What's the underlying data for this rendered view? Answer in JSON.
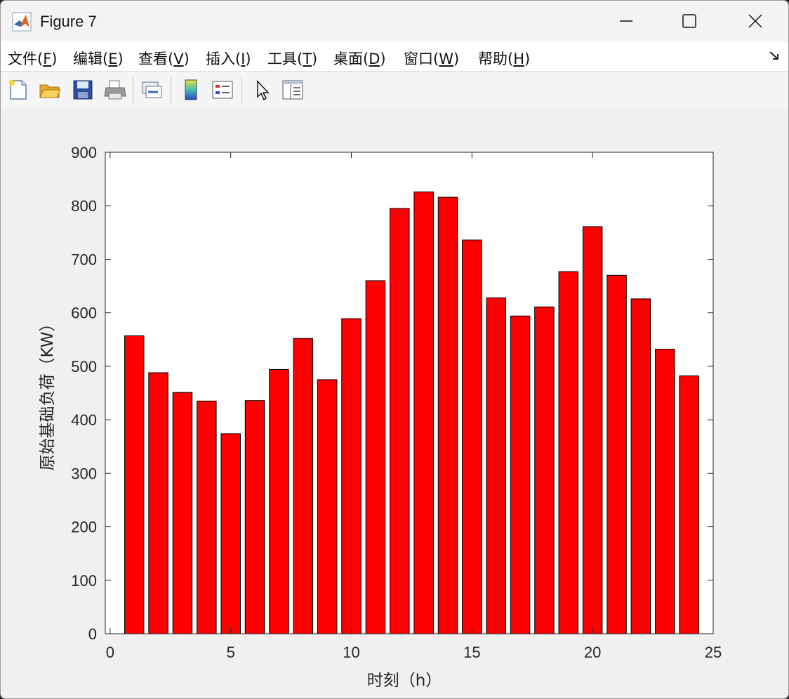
{
  "window": {
    "title": "Figure 7",
    "icons": [
      "matlab-logo-icon",
      "minimize-icon",
      "maximize-icon",
      "close-icon"
    ]
  },
  "menu": {
    "items": [
      {
        "label": "文件(",
        "key": "F",
        "suffix": ")"
      },
      {
        "label": "编辑(",
        "key": "E",
        "suffix": ")"
      },
      {
        "label": "查看(",
        "key": "V",
        "suffix": ")"
      },
      {
        "label": "插入(",
        "key": "I",
        "suffix": ")"
      },
      {
        "label": "工具(",
        "key": "T",
        "suffix": ")"
      },
      {
        "label": "桌面(",
        "key": "D",
        "suffix": ")"
      },
      {
        "label": "窗口(",
        "key": "W",
        "suffix": ")"
      },
      {
        "label": "帮助(",
        "key": "H",
        "suffix": ")"
      }
    ],
    "dock_icon": "dock-arrow-icon"
  },
  "toolbar": {
    "icons": [
      "new-figure-icon",
      "open-file-icon",
      "save-icon",
      "print-icon",
      "link-icon",
      "colorbar-icon",
      "legend-icon",
      "pointer-icon",
      "property-editor-icon"
    ]
  },
  "chart_data": {
    "type": "bar",
    "x": [
      1,
      2,
      3,
      4,
      5,
      6,
      7,
      8,
      9,
      10,
      11,
      12,
      13,
      14,
      15,
      16,
      17,
      18,
      19,
      20,
      21,
      22,
      23,
      24
    ],
    "values": [
      557,
      488,
      451,
      435,
      374,
      436,
      494,
      552,
      475,
      589,
      660,
      795,
      826,
      816,
      736,
      628,
      594,
      611,
      677,
      761,
      670,
      626,
      532,
      482
    ],
    "bar_color": "#ff0000",
    "edge_color": "#000000",
    "xlabel": "时刻（h）",
    "ylabel": "原始基础负荷（KW）",
    "xlim": [
      -0.2,
      25
    ],
    "ylim": [
      0,
      900
    ],
    "xticks": [
      "0",
      "5",
      "10",
      "15",
      "20",
      "25"
    ],
    "yticks": [
      "0",
      "100",
      "200",
      "300",
      "400",
      "500",
      "600",
      "700",
      "800",
      "900"
    ],
    "grid": false
  }
}
